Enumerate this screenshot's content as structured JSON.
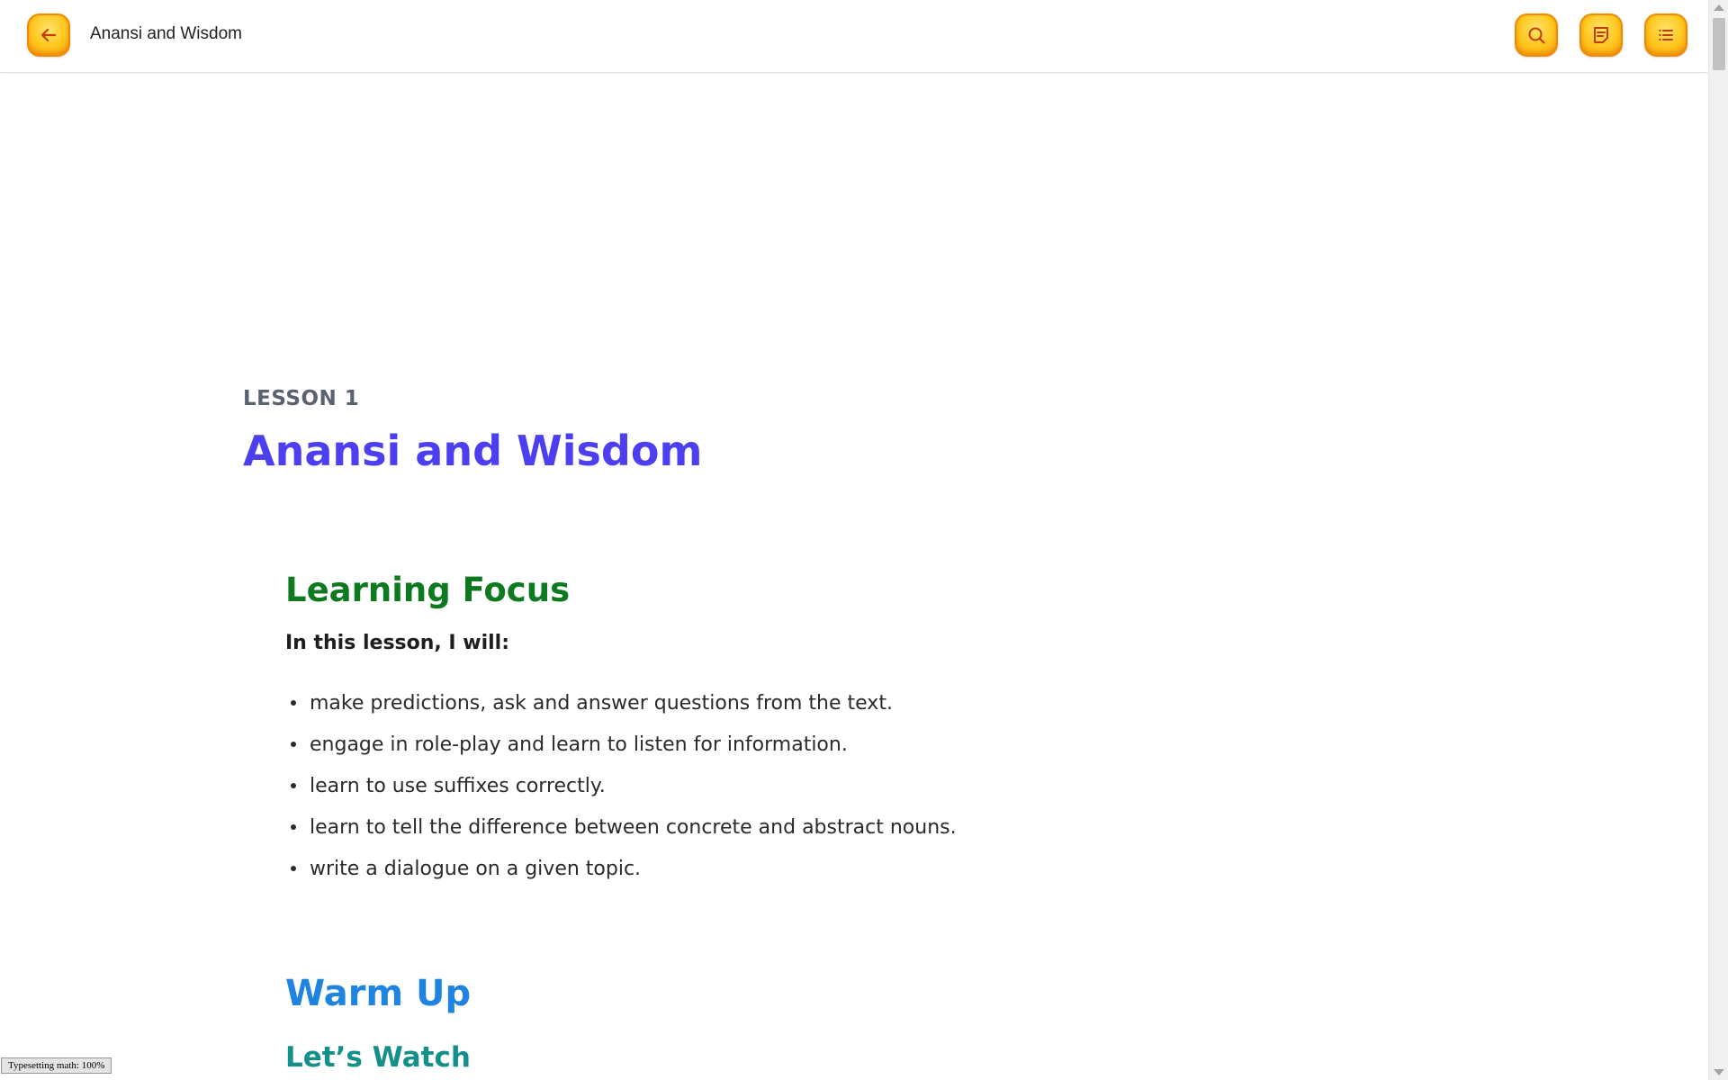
{
  "header": {
    "title": "Anansi and Wisdom",
    "back_icon": "arrow-left-icon",
    "search_icon": "search-icon",
    "notes_icon": "notes-icon",
    "toc_icon": "list-icon"
  },
  "lesson": {
    "label": "LESSON 1",
    "title": "Anansi and Wisdom"
  },
  "learning_focus": {
    "heading": "Learning Focus",
    "intro": "In this lesson, I will:",
    "items": [
      "make predictions, ask and answer questions from the text.",
      "engage in role-play and learn to listen for information.",
      "learn to use suffixes correctly.",
      "learn to tell the difference between concrete and abstract nouns.",
      "write a dialogue on a given topic."
    ]
  },
  "warm_up": {
    "heading": "Warm Up",
    "subheading": "Let’s Watch"
  },
  "status": {
    "text": "Typesetting math: 100%"
  },
  "colors": {
    "button_fill": "#ffc61c",
    "button_border": "#f08a00",
    "lesson_title": "#4b3ff0",
    "focus_heading": "#0e7a1f",
    "warm_heading": "#1f84e0",
    "watch_heading": "#14908a"
  }
}
